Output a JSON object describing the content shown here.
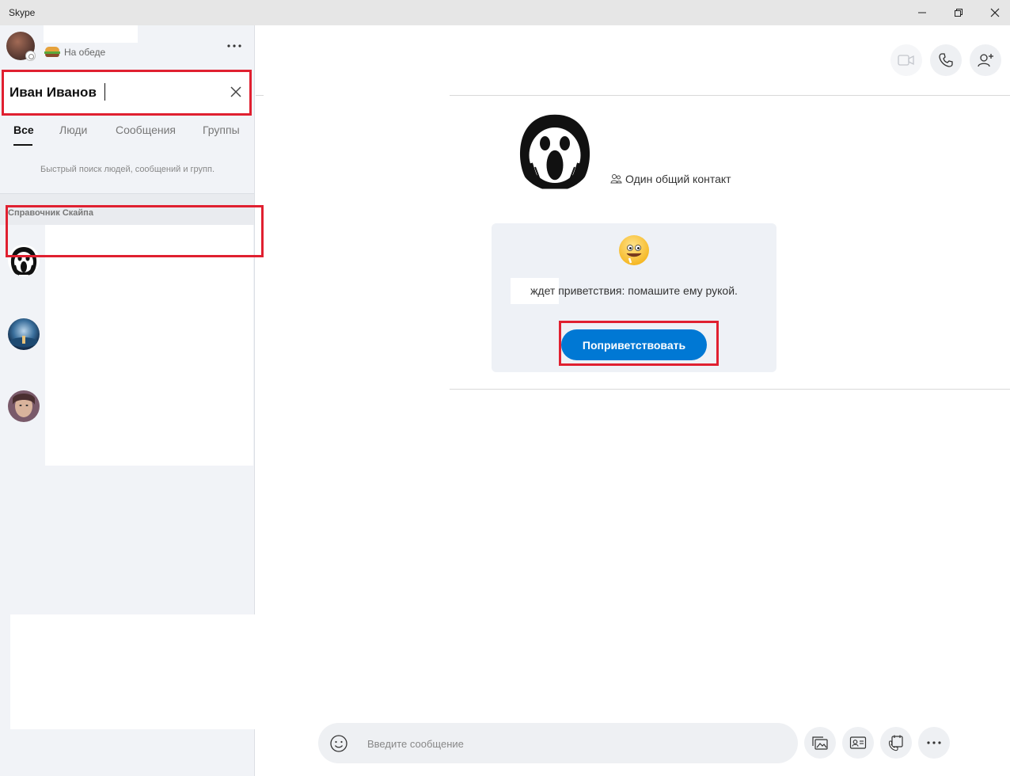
{
  "window": {
    "title": "Skype",
    "controls": [
      "minimize-icon",
      "restore-icon",
      "close-icon"
    ]
  },
  "profile": {
    "status_text": "На обеде",
    "status_icon": "burger-icon"
  },
  "search": {
    "value": "Иван Иванов",
    "clear_icon": "close-icon"
  },
  "tabs": [
    {
      "label": "Все",
      "active": true
    },
    {
      "label": "Люди",
      "active": false
    },
    {
      "label": "Сообщения",
      "active": false
    },
    {
      "label": "Группы",
      "active": false
    }
  ],
  "search_hint": "Быстрый поиск людей, сообщений и групп.",
  "directory": {
    "header": "Справочник Скайпа"
  },
  "header_actions": {
    "video_icon": "video-call-icon",
    "audio_icon": "phone-icon",
    "add_icon": "add-person-icon"
  },
  "contact": {
    "common_contacts": "Один общий контакт"
  },
  "welcome": {
    "message": "ждет приветствия: помашите ему рукой.",
    "button": "Поприветствовать"
  },
  "composer": {
    "placeholder": "Введите сообщение"
  },
  "colors": {
    "accent": "#0078d4",
    "highlight": "#e02030",
    "sidebar_bg": "#f1f3f7"
  }
}
